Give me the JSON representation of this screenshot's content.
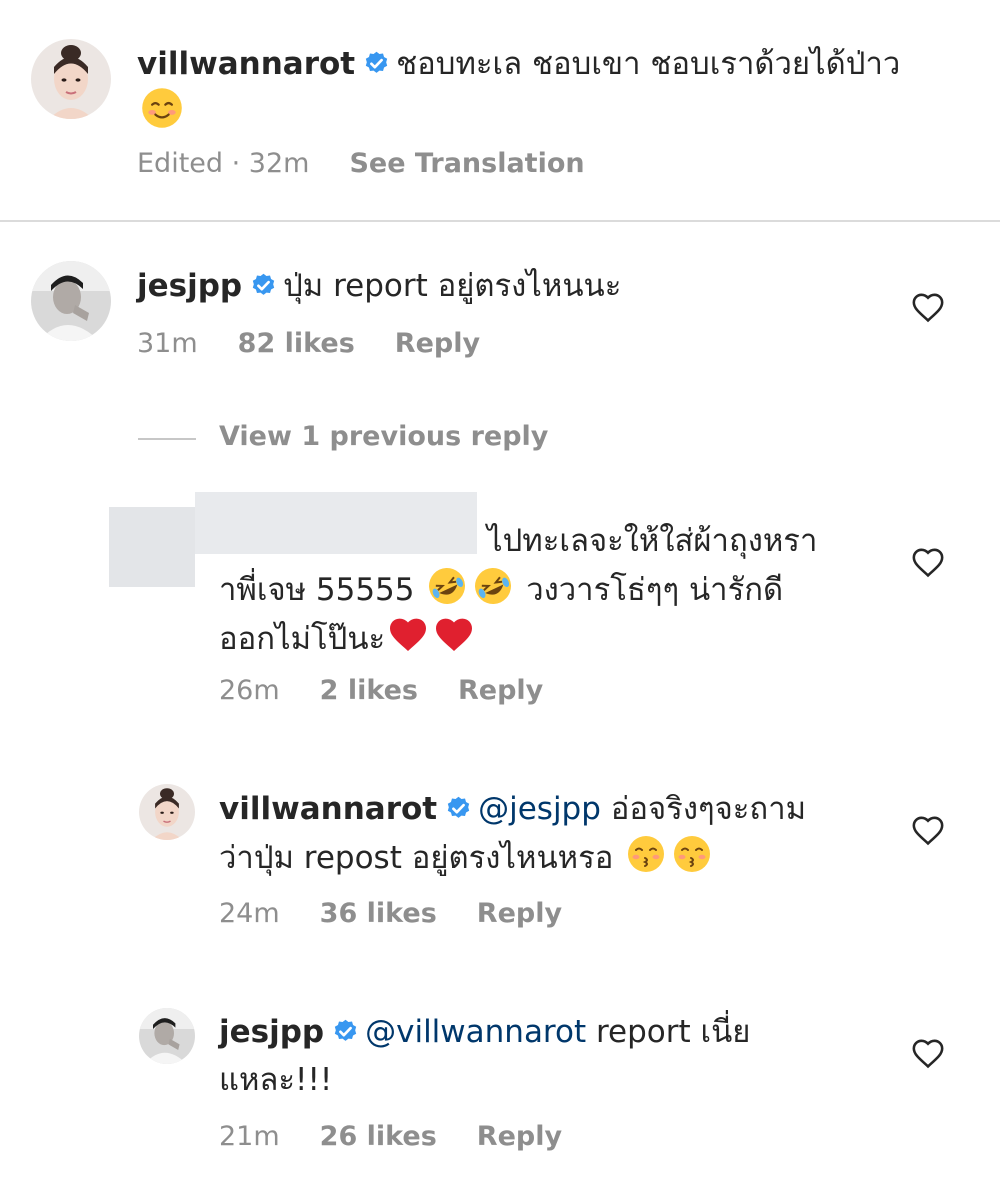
{
  "caption": {
    "username": "villwannarot",
    "text": "ชอบทะเล ชอบเขา ชอบเราด้วยได้ป่าว",
    "emoji": "smiling-face-emoji",
    "edited": "Edited · 32m",
    "see_translation": "See Translation"
  },
  "comments": [
    {
      "username": "jesjpp",
      "text": "ปุ่ม report อยู่ตรงไหนนะ",
      "time": "31m",
      "likes": "82 likes",
      "reply": "Reply"
    },
    {
      "view_previous": "View 1 previous reply"
    },
    {
      "username": "",
      "text_line1": "ไปทะเลจะให้ใส่ผ้าถุงหรา",
      "text_line2a": "าพี่เจษ 55555",
      "text_line2b": "วงวารโธ่ๆๆ น่ารักดี",
      "text_line3": "ออกไม่โป๊นะ",
      "time": "26m",
      "likes": "2 likes",
      "reply": "Reply"
    },
    {
      "username": "villwannarot",
      "mention": "@jesjpp",
      "text_line1": "อ่อจริงๆจะถาม",
      "text_line2": "ว่าปุ่ม repost อยู่ตรงไหนหรอ",
      "time": "24m",
      "likes": "36 likes",
      "reply": "Reply"
    },
    {
      "username": "jesjpp",
      "mention": "@villwannarot",
      "text_line1": "report เนี่ย",
      "text_line2": "แหละ!!!",
      "time": "21m",
      "likes": "26 likes",
      "reply": "Reply"
    }
  ],
  "colors": {
    "verified_blue": "#3897f0",
    "mention_blue": "#00376b",
    "meta_gray": "#8e8e8e",
    "heart_red": "#e0202f"
  }
}
